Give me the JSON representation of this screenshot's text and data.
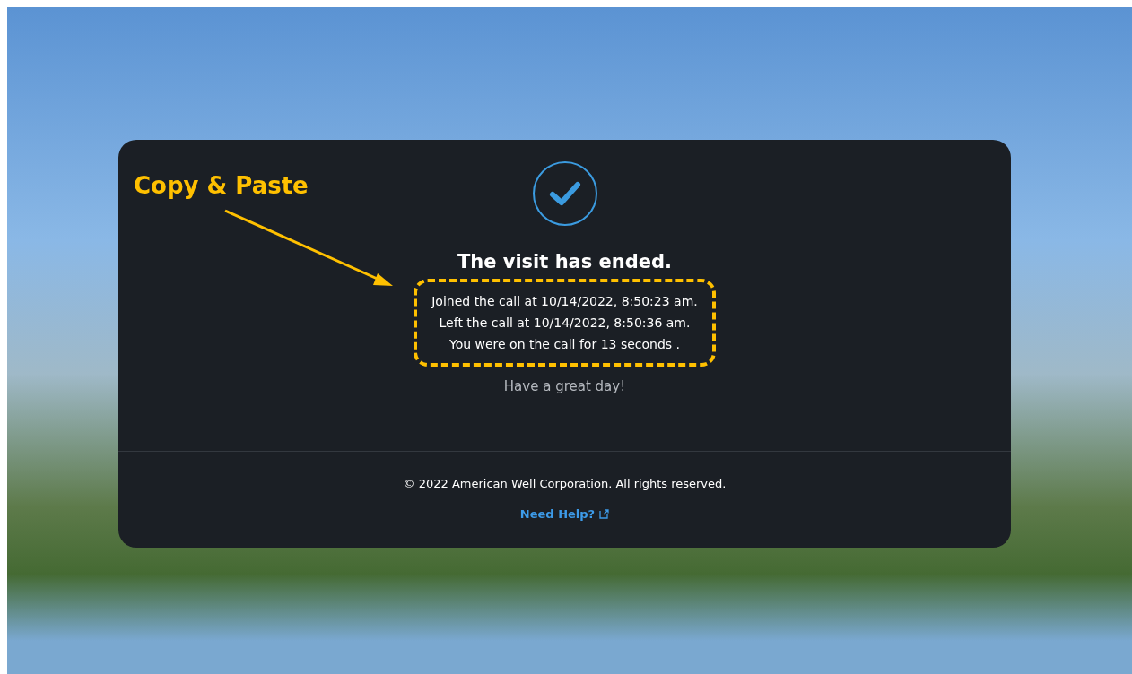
{
  "annotation": {
    "label": "Copy & Paste"
  },
  "card": {
    "title": "The visit has ended.",
    "details": [
      "Joined the call at 10/14/2022, 8:50:23 am.",
      "Left the call at 10/14/2022, 8:50:36 am.",
      "You were on the call for 13 seconds ."
    ],
    "farewell": "Have a great day!"
  },
  "footer": {
    "copyright": "© 2022 American Well Corporation. All rights reserved.",
    "help_link": "Need Help?"
  }
}
